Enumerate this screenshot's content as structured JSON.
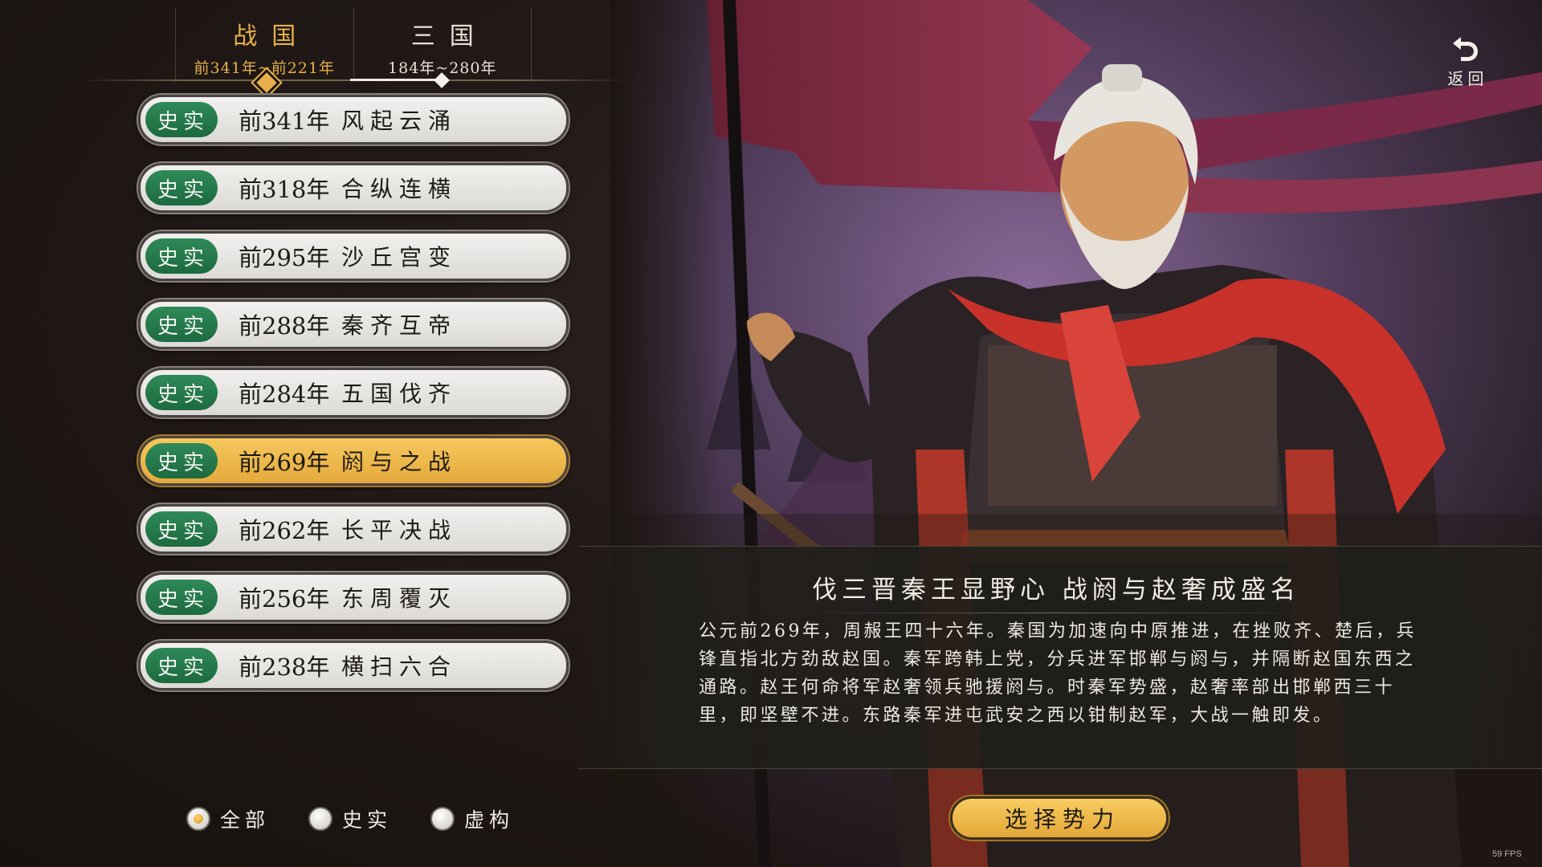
{
  "eras": [
    {
      "name": "战国",
      "range": "前341年~前221年",
      "active": true
    },
    {
      "name": "三国",
      "range": "184年~280年",
      "active": false
    }
  ],
  "scenarios": [
    {
      "tag": "史实",
      "year": "前341年",
      "name": "风起云涌"
    },
    {
      "tag": "史实",
      "year": "前318年",
      "name": "合纵连横"
    },
    {
      "tag": "史实",
      "year": "前295年",
      "name": "沙丘宫变"
    },
    {
      "tag": "史实",
      "year": "前288年",
      "name": "秦齐互帝"
    },
    {
      "tag": "史实",
      "year": "前284年",
      "name": "五国伐齐"
    },
    {
      "tag": "史实",
      "year": "前269年",
      "name": "阏与之战",
      "selected": true
    },
    {
      "tag": "史实",
      "year": "前262年",
      "name": "长平决战"
    },
    {
      "tag": "史实",
      "year": "前256年",
      "name": "东周覆灭"
    },
    {
      "tag": "史实",
      "year": "前238年",
      "name": "横扫六合"
    }
  ],
  "description": {
    "title": "伐三晋秦王显野心 战阏与赵奢成盛名",
    "body": "公元前269年，周赧王四十六年。秦国为加速向中原推进，在挫败齐、楚后，兵锋直指北方劲敌赵国。秦军跨韩上党，分兵进军邯郸与阏与，并隔断赵国东西之通路。赵王何命将军赵奢领兵驰援阏与。时秦军势盛，赵奢率部出邯郸西三十里，即坚壁不进。东路秦军进屯武安之西以钳制赵军，大战一触即发。"
  },
  "filters": [
    {
      "label": "全部",
      "checked": true
    },
    {
      "label": "史实",
      "checked": false
    },
    {
      "label": "虚构",
      "checked": false
    }
  ],
  "select_button": {
    "label": "选择势力"
  },
  "back_button": {
    "label": "返回",
    "icon": "undo-arrow-icon"
  },
  "fps": "59 FPS",
  "colors": {
    "accent_gold": "#e7b04a",
    "badge_green": "#1d6a40",
    "pill_grey": "#e6e4e0"
  }
}
